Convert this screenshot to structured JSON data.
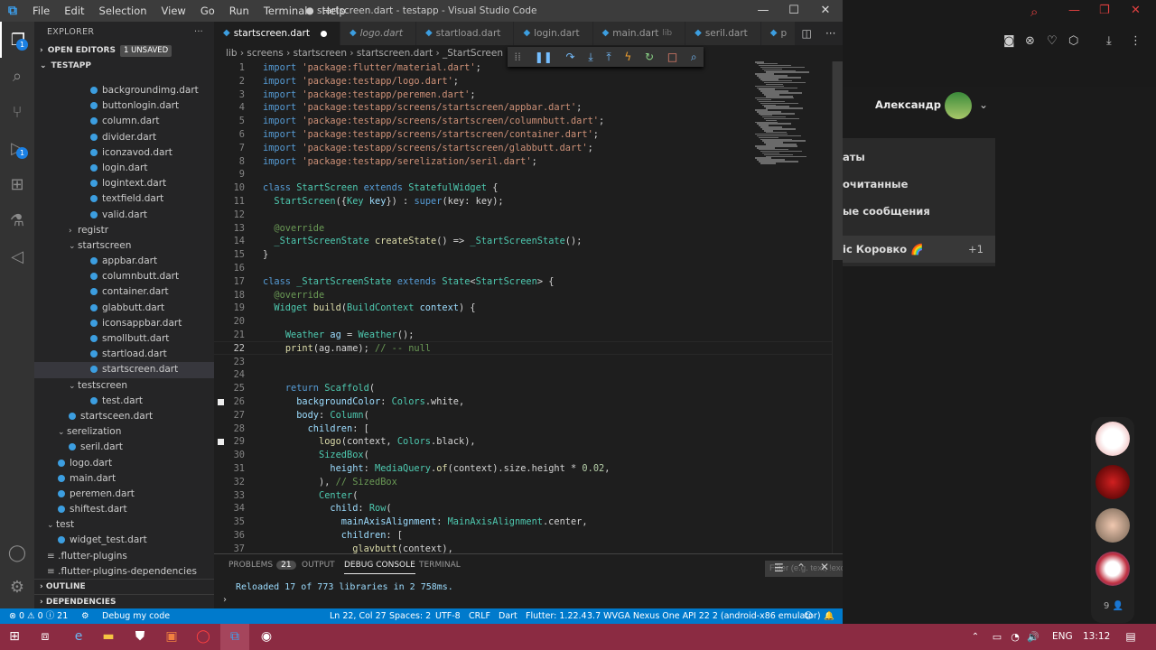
{
  "titlebar": {
    "menu": [
      "File",
      "Edit",
      "Selection",
      "View",
      "Go",
      "Run",
      "Terminal",
      "Help"
    ],
    "title": "● startscreen.dart - testapp - Visual Studio Code",
    "min": "—",
    "max": "☐",
    "close": "✕"
  },
  "activity": {
    "explorer_badge": "1",
    "debug_badge": "1"
  },
  "sidebar": {
    "title": "EXPLORER",
    "more": "···",
    "open_editors": "OPEN EDITORS",
    "unsaved": "1 UNSAVED",
    "project": "TESTAPP",
    "items": [
      {
        "label": "backgroundimg.dart",
        "type": "dart",
        "indent": 2
      },
      {
        "label": "buttonlogin.dart",
        "type": "dart",
        "indent": 2
      },
      {
        "label": "column.dart",
        "type": "dart",
        "indent": 2
      },
      {
        "label": "divider.dart",
        "type": "dart",
        "indent": 2
      },
      {
        "label": "iconzavod.dart",
        "type": "dart",
        "indent": 2
      },
      {
        "label": "login.dart",
        "type": "dart",
        "indent": 2
      },
      {
        "label": "logintext.dart",
        "type": "dart",
        "indent": 2
      },
      {
        "label": "textfield.dart",
        "type": "dart",
        "indent": 2
      },
      {
        "label": "valid.dart",
        "type": "dart",
        "indent": 2
      },
      {
        "label": "registr",
        "type": "folder-closed",
        "indent": 1
      },
      {
        "label": "startscreen",
        "type": "folder-open",
        "indent": 1
      },
      {
        "label": "appbar.dart",
        "type": "dart",
        "indent": 2
      },
      {
        "label": "columnbutt.dart",
        "type": "dart",
        "indent": 2
      },
      {
        "label": "container.dart",
        "type": "dart",
        "indent": 2
      },
      {
        "label": "glabbutt.dart",
        "type": "dart",
        "indent": 2
      },
      {
        "label": "iconsappbar.dart",
        "type": "dart",
        "indent": 2
      },
      {
        "label": "smollbutt.dart",
        "type": "dart",
        "indent": 2
      },
      {
        "label": "startload.dart",
        "type": "dart",
        "indent": 2
      },
      {
        "label": "startscreen.dart",
        "type": "dart",
        "indent": 2,
        "selected": true
      },
      {
        "label": "testscreen",
        "type": "folder-open",
        "indent": 1
      },
      {
        "label": "test.dart",
        "type": "dart",
        "indent": 2
      },
      {
        "label": "startsceen.dart",
        "type": "dart",
        "indent": 1
      },
      {
        "label": "serelization",
        "type": "folder-open",
        "indent": 0.5
      },
      {
        "label": "seril.dart",
        "type": "dart",
        "indent": 1
      },
      {
        "label": "logo.dart",
        "type": "dart",
        "indent": 0.5
      },
      {
        "label": "main.dart",
        "type": "dart",
        "indent": 0.5
      },
      {
        "label": "peremen.dart",
        "type": "dart",
        "indent": 0.5
      },
      {
        "label": "shiftest.dart",
        "type": "dart",
        "indent": 0.5
      },
      {
        "label": "test",
        "type": "folder-open",
        "indent": 0
      },
      {
        "label": "widget_test.dart",
        "type": "dart",
        "indent": 0.5
      },
      {
        "label": ".flutter-plugins",
        "type": "file",
        "indent": 0
      },
      {
        "label": ".flutter-plugins-dependencies",
        "type": "file",
        "indent": 0
      }
    ],
    "outline": "OUTLINE",
    "dependencies": "DEPENDENCIES"
  },
  "tabs": [
    {
      "label": "startscreen.dart",
      "active": true,
      "dirty": true
    },
    {
      "label": "logo.dart",
      "italic": true
    },
    {
      "label": "startload.dart"
    },
    {
      "label": "login.dart"
    },
    {
      "label": "main.dart",
      "hint": "lib"
    },
    {
      "label": "seril.dart"
    },
    {
      "label": "p"
    }
  ],
  "breadcrumbs": [
    "lib",
    "screens",
    "startscreen",
    "startscreen.dart",
    "_StartScreen"
  ],
  "debug_toolbar": [
    "⁞⁞",
    "❚❚",
    "↷",
    "⤓",
    "⤒",
    "ϟ",
    "↻",
    "□",
    "⌕"
  ],
  "editor": {
    "line_numbers": [
      "1",
      "2",
      "3",
      "4",
      "5",
      "6",
      "7",
      "8",
      "9",
      "10",
      "11",
      "12",
      "13",
      "14",
      "15",
      "16",
      "17",
      "18",
      "19",
      "20",
      "21",
      "22",
      "23",
      "24",
      "25",
      "26",
      "27",
      "28",
      "29",
      "30",
      "31",
      "32",
      "33",
      "34",
      "35",
      "36",
      "37"
    ],
    "current_line": "22",
    "lines": [
      [
        [
          "k",
          "import "
        ],
        [
          "s",
          "'package:flutter/material.dart'"
        ],
        [
          "p",
          ";"
        ]
      ],
      [
        [
          "k",
          "import "
        ],
        [
          "s",
          "'package:testapp/logo.dart'"
        ],
        [
          "p",
          ";"
        ]
      ],
      [
        [
          "k",
          "import "
        ],
        [
          "s",
          "'package:testapp/peremen.dart'"
        ],
        [
          "p",
          ";"
        ]
      ],
      [
        [
          "k",
          "import "
        ],
        [
          "s",
          "'package:testapp/screens/startscreen/appbar.dart'"
        ],
        [
          "p",
          ";"
        ]
      ],
      [
        [
          "k",
          "import "
        ],
        [
          "s",
          "'package:testapp/screens/startscreen/columnbutt.dart'"
        ],
        [
          "p",
          ";"
        ]
      ],
      [
        [
          "k",
          "import "
        ],
        [
          "s",
          "'package:testapp/screens/startscreen/container.dart'"
        ],
        [
          "p",
          ";"
        ]
      ],
      [
        [
          "k",
          "import "
        ],
        [
          "s",
          "'package:testapp/screens/startscreen/glabbutt.dart'"
        ],
        [
          "p",
          ";"
        ]
      ],
      [
        [
          "k",
          "import "
        ],
        [
          "s",
          "'package:testapp/serelization/seril.dart'"
        ],
        [
          "p",
          ";"
        ]
      ],
      [],
      [
        [
          "k",
          "class "
        ],
        [
          "t",
          "StartScreen "
        ],
        [
          "k",
          "extends "
        ],
        [
          "t",
          "StatefulWidget"
        ],
        [
          "p",
          " {"
        ]
      ],
      [
        [
          "p",
          "  "
        ],
        [
          "t",
          "StartScreen"
        ],
        [
          "p",
          "({"
        ],
        [
          "t",
          "Key "
        ],
        [
          "v",
          "key"
        ],
        [
          "p",
          "}) : "
        ],
        [
          "k",
          "super"
        ],
        [
          "p",
          "(key: key);"
        ]
      ],
      [],
      [
        [
          "p",
          "  "
        ],
        [
          "c",
          "@override"
        ]
      ],
      [
        [
          "p",
          "  "
        ],
        [
          "t",
          "_StartScreenState "
        ],
        [
          "f",
          "createState"
        ],
        [
          "p",
          "() => "
        ],
        [
          "t",
          "_StartScreenState"
        ],
        [
          "p",
          "();"
        ]
      ],
      [
        [
          "p",
          "}"
        ]
      ],
      [],
      [
        [
          "k",
          "class "
        ],
        [
          "t",
          "_StartScreenState "
        ],
        [
          "k",
          "extends "
        ],
        [
          "t",
          "State"
        ],
        [
          "p",
          "<"
        ],
        [
          "t",
          "StartScreen"
        ],
        [
          "p",
          "> {"
        ]
      ],
      [
        [
          "p",
          "  "
        ],
        [
          "c",
          "@override"
        ]
      ],
      [
        [
          "p",
          "  "
        ],
        [
          "t",
          "Widget "
        ],
        [
          "f",
          "build"
        ],
        [
          "p",
          "("
        ],
        [
          "t",
          "BuildContext "
        ],
        [
          "v",
          "context"
        ],
        [
          "p",
          ") {"
        ]
      ],
      [],
      [
        [
          "p",
          "    "
        ],
        [
          "t",
          "Weather "
        ],
        [
          "v",
          "ag"
        ],
        [
          "p",
          " = "
        ],
        [
          "t",
          "Weather"
        ],
        [
          "p",
          "();"
        ]
      ],
      [
        [
          "p",
          "    "
        ],
        [
          "f",
          "print"
        ],
        [
          "p",
          "(ag.name); "
        ],
        [
          "c",
          "// -- null"
        ]
      ],
      [],
      [],
      [
        [
          "p",
          "    "
        ],
        [
          "k",
          "return "
        ],
        [
          "t",
          "Scaffold"
        ],
        [
          "p",
          "("
        ]
      ],
      [
        [
          "p",
          "      "
        ],
        [
          "v",
          "backgroundColor"
        ],
        [
          "p",
          ": "
        ],
        [
          "t",
          "Colors"
        ],
        [
          "p",
          ".white,"
        ]
      ],
      [
        [
          "p",
          "      "
        ],
        [
          "v",
          "body"
        ],
        [
          "p",
          ": "
        ],
        [
          "t",
          "Column"
        ],
        [
          "p",
          "("
        ]
      ],
      [
        [
          "p",
          "        "
        ],
        [
          "v",
          "children"
        ],
        [
          "p",
          ": ["
        ]
      ],
      [
        [
          "p",
          "          "
        ],
        [
          "f",
          "logo"
        ],
        [
          "p",
          "(context, "
        ],
        [
          "t",
          "Colors"
        ],
        [
          "p",
          ".black),"
        ]
      ],
      [
        [
          "p",
          "          "
        ],
        [
          "t",
          "SizedBox"
        ],
        [
          "p",
          "("
        ]
      ],
      [
        [
          "p",
          "            "
        ],
        [
          "v",
          "height"
        ],
        [
          "p",
          ": "
        ],
        [
          "t",
          "MediaQuery"
        ],
        [
          "p",
          "."
        ],
        [
          "f",
          "of"
        ],
        [
          "p",
          "(context).size.height * "
        ],
        [
          "n",
          "0.02"
        ],
        [
          "p",
          ","
        ]
      ],
      [
        [
          "p",
          "          ), "
        ],
        [
          "c",
          "// SizedBox"
        ]
      ],
      [
        [
          "p",
          "          "
        ],
        [
          "t",
          "Center"
        ],
        [
          "p",
          "("
        ]
      ],
      [
        [
          "p",
          "            "
        ],
        [
          "v",
          "child"
        ],
        [
          "p",
          ": "
        ],
        [
          "t",
          "Row"
        ],
        [
          "p",
          "("
        ]
      ],
      [
        [
          "p",
          "              "
        ],
        [
          "v",
          "mainAxisAlignment"
        ],
        [
          "p",
          ": "
        ],
        [
          "t",
          "MainAxisAlignment"
        ],
        [
          "p",
          ".center,"
        ]
      ],
      [
        [
          "p",
          "              "
        ],
        [
          "v",
          "children"
        ],
        [
          "p",
          ": ["
        ]
      ],
      [
        [
          "p",
          "                "
        ],
        [
          "f",
          "glavbutt"
        ],
        [
          "p",
          "(context),"
        ]
      ]
    ]
  },
  "panel": {
    "tabs": [
      "PROBLEMS",
      "OUTPUT",
      "DEBUG CONSOLE",
      "TERMINAL"
    ],
    "problems_count": "21",
    "filter_placeholder": "Filter (e.g. text, !exclude)",
    "console": "Reloaded 17 of 773 libraries in 2 758ms."
  },
  "statusbar": {
    "errors": "⊗ 0 ⚠ 0 ⓘ 21",
    "debug": "Debug my code",
    "position": "Ln 22, Col 27",
    "spaces": "Spaces: 2",
    "encoding": "UTF-8",
    "eol": "CRLF",
    "language": "Dart",
    "flutter": "Flutter: 1.22.4",
    "device": "3.7 WVGA Nexus One API 22 2 (android-x86 emulator)"
  },
  "messenger": {
    "user_name": "Александр",
    "menu": [
      "аты",
      "очитанные",
      "ые сообщения",
      "іс Коровко 🌈"
    ],
    "counter": "+1",
    "online_count": "9"
  },
  "taskbar": {
    "lang": "ENG",
    "time": "13:12"
  },
  "colors": {
    "accent": "#007acc",
    "taskbar": "#8b2b42",
    "dart_icon": "#3c9ee0"
  }
}
